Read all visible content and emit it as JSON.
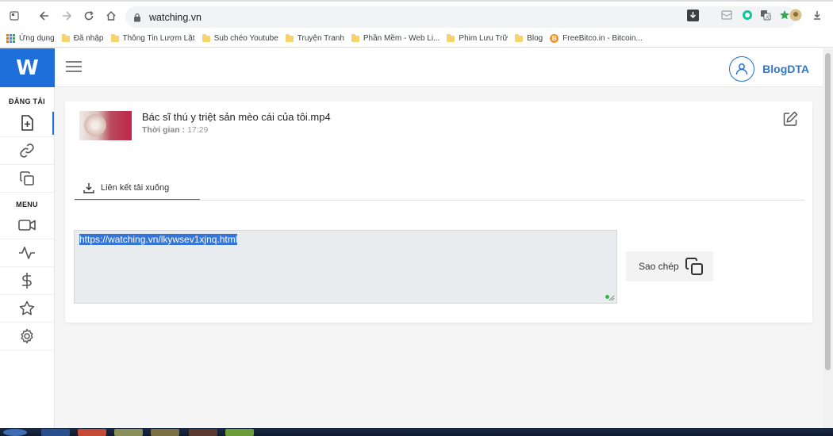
{
  "browser": {
    "url": "watching.vn"
  },
  "bookmarks": [
    {
      "label": "Ứng dụng",
      "kind": "apps"
    },
    {
      "label": "Đã nhập",
      "kind": "folder"
    },
    {
      "label": "Thông Tin Lượm Lặt",
      "kind": "folder"
    },
    {
      "label": "Sub chéo Youtube",
      "kind": "folder"
    },
    {
      "label": "Truyện Tranh",
      "kind": "folder"
    },
    {
      "label": "Phần Mềm - Web Li...",
      "kind": "folder"
    },
    {
      "label": "Phim Lưu Trữ",
      "kind": "folder"
    },
    {
      "label": "Blog",
      "kind": "folder"
    },
    {
      "label": "FreeBitco.in - Bitcoin...",
      "kind": "btc"
    }
  ],
  "sidebar": {
    "logo": "W",
    "section_upload": "ĐĂNG TẢI",
    "section_menu": "MENU",
    "upload_items": [
      "file-plus-icon",
      "link-icon",
      "copy-icon"
    ],
    "menu_items": [
      "video-camera-icon",
      "activity-icon",
      "dollar-icon",
      "star-icon",
      "gear-icon"
    ]
  },
  "header": {
    "username": "BlogDTA"
  },
  "video": {
    "title": "Bác sĩ thú y triệt sản mèo cái của tôi.mp4",
    "time_label": "Thời gian :",
    "time_value": "17:29"
  },
  "tab": {
    "label": "Liên kết tải xuống"
  },
  "link": {
    "value": "https://watching.vn/lkywsev1xjnq.html"
  },
  "copy_button": {
    "label": "Sao chép"
  },
  "colors": {
    "brand": "#1e6fd9",
    "username": "#3178c6",
    "selection": "#3476d8"
  }
}
